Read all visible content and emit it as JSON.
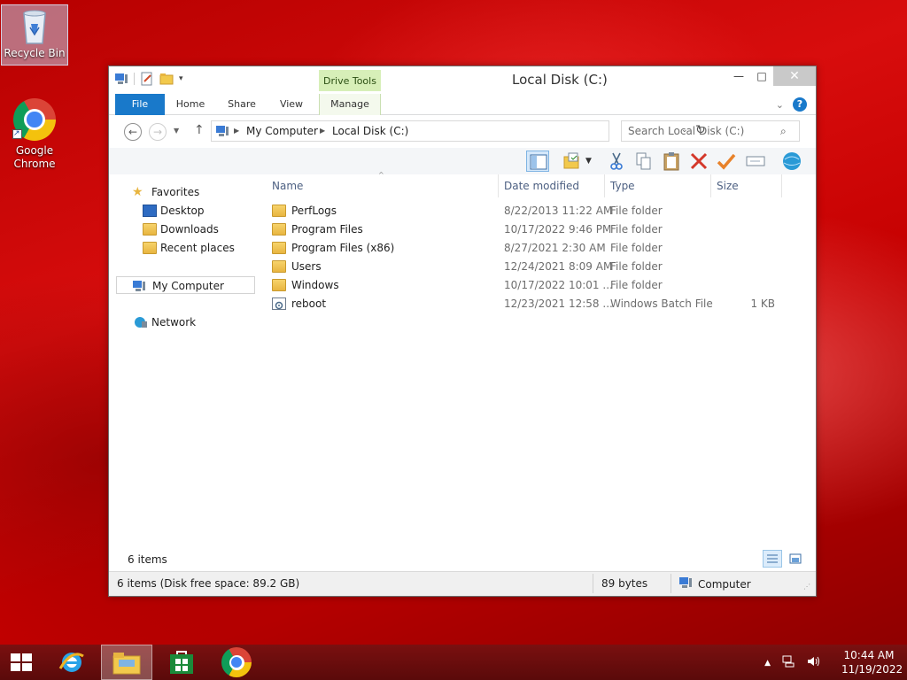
{
  "desktop": {
    "icons": [
      {
        "label": "Recycle Bin"
      },
      {
        "label": "Google Chrome"
      }
    ]
  },
  "window": {
    "title": "Local Disk (C:)",
    "contextual_tab_group": "Drive Tools",
    "ribbon_tabs": {
      "file": "File",
      "home": "Home",
      "share": "Share",
      "view": "View",
      "manage": "Manage"
    },
    "controls": {
      "minimize": "—",
      "maximize": "□",
      "close": "✕"
    },
    "address": {
      "breadcrumbs": [
        "My Computer",
        "Local Disk (C:)"
      ]
    },
    "search": {
      "placeholder": "Search Local Disk (C:)"
    },
    "nav_pane": {
      "favorites": "Favorites",
      "favorites_items": [
        "Desktop",
        "Downloads",
        "Recent places"
      ],
      "my_computer": "My Computer",
      "network": "Network"
    },
    "columns": {
      "name": "Name",
      "date": "Date modified",
      "type": "Type",
      "size": "Size"
    },
    "files": [
      {
        "name": "PerfLogs",
        "date": "8/22/2013 11:22 AM",
        "type": "File folder",
        "size": "",
        "icon": "folder-icon"
      },
      {
        "name": "Program Files",
        "date": "10/17/2022 9:46 PM",
        "type": "File folder",
        "size": "",
        "icon": "folder-icon"
      },
      {
        "name": "Program Files (x86)",
        "date": "8/27/2021 2:30 AM",
        "type": "File folder",
        "size": "",
        "icon": "folder-icon"
      },
      {
        "name": "Users",
        "date": "12/24/2021 8:09 AM",
        "type": "File folder",
        "size": "",
        "icon": "folder-icon"
      },
      {
        "name": "Windows",
        "date": "10/17/2022 10:01 ...",
        "type": "File folder",
        "size": "",
        "icon": "folder-icon"
      },
      {
        "name": "reboot",
        "date": "12/23/2021 12:58 ...",
        "type": "Windows Batch File",
        "size": "1 KB",
        "icon": "batch-file-icon"
      }
    ],
    "item_count": "6 items",
    "status": {
      "left": "6 items (Disk free space: 89.2 GB)",
      "bytes": "89 bytes",
      "zone": "Computer"
    }
  },
  "taskbar": {
    "clock_time": "10:44 AM",
    "clock_date": "11/19/2022"
  },
  "colors": {
    "accent": "#1979ca",
    "drive_tools": "#d7efb8",
    "desktop": "#c40000"
  }
}
